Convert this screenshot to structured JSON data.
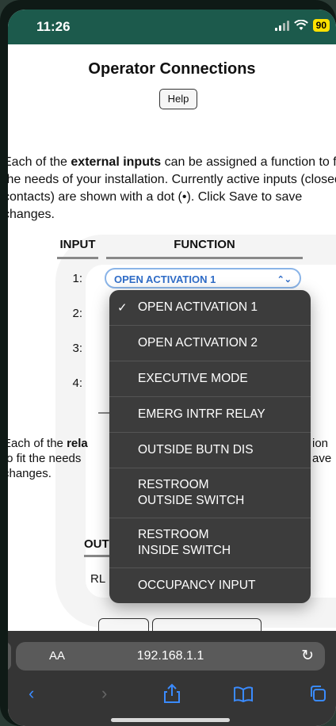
{
  "status_bar": {
    "time": "11:26",
    "battery": "90"
  },
  "page": {
    "title": "Operator Connections",
    "help_label": "Help",
    "intro_pre": "Each of the ",
    "intro_bold": "external inputs",
    "intro_post": " can be assigned a function to fit the needs of your installation. Currently active inputs (closed contacts) are shown with a dot (•). Click Save to save changes.",
    "table": {
      "input_header": "INPUT",
      "function_header": "FUNCTION",
      "rows": [
        "1:",
        "2:",
        "3:",
        "4:"
      ],
      "row1_value": "OPEN ACTIVATION 1"
    },
    "relay_para_a": "Each of the ",
    "relay_para_bold": "rela",
    "relay_para_b": "to fit the needs",
    "relay_para_c": "changes.",
    "relay_right_a": "ion",
    "relay_right_b": "ave",
    "outputs_header": "OUT",
    "relay_row": "RL"
  },
  "dropdown": {
    "selected": "OPEN ACTIVATION 1",
    "options": [
      [
        "OPEN ACTIVATION 1"
      ],
      [
        "OPEN ACTIVATION 2"
      ],
      [
        "EXECUTIVE MODE"
      ],
      [
        "EMERG INTRF RELAY"
      ],
      [
        "OUTSIDE BUTN DIS"
      ],
      [
        "RESTROOM",
        "OUTSIDE SWITCH"
      ],
      [
        "RESTROOM",
        "INSIDE SWITCH"
      ],
      [
        "OCCUPANCY INPUT"
      ]
    ]
  },
  "browser": {
    "aa": "AA",
    "url": "192.168.1.1"
  },
  "colors": {
    "status_bar": "#1c5a4c",
    "accent": "#2f6cc7",
    "menu_bg": "#3c3c3c",
    "nav_icon": "#3a8bff"
  }
}
